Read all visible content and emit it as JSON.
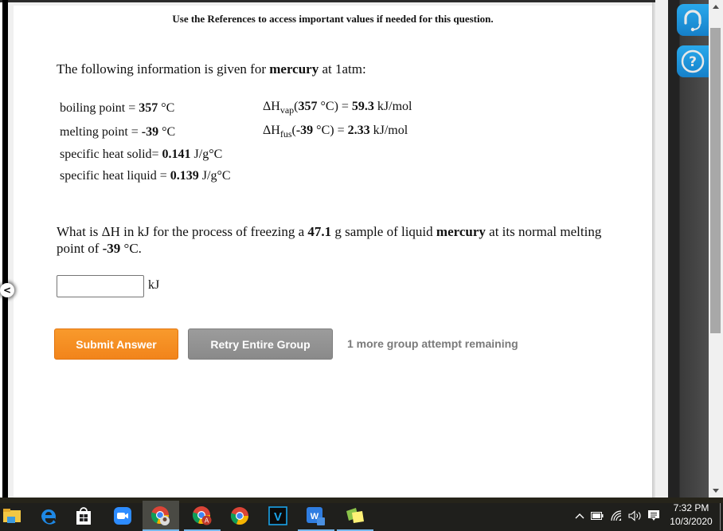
{
  "page": {
    "references_note": "Use the References to access important values if needed for this question."
  },
  "question": {
    "intro_prefix": "The following information is given for ",
    "intro_substance": "mercury",
    "intro_suffix": " at 1atm:",
    "properties": {
      "boiling_point_label": "boiling point = ",
      "boiling_point_value": "357",
      "boiling_point_unit": " °C",
      "melting_point_label": "melting point = ",
      "melting_point_value": "-39",
      "melting_point_unit": " °C",
      "specific_heat_solid_label": "specific heat solid= ",
      "specific_heat_solid_value": "0.141",
      "specific_heat_solid_unit": " J/g°C",
      "specific_heat_liquid_label": "specific heat liquid = ",
      "specific_heat_liquid_value": "0.139",
      "specific_heat_liquid_unit": " J/g°C",
      "dh_vap_symbol": "ΔH",
      "dh_vap_sub": "vap",
      "dh_vap_open": "(",
      "dh_vap_temp": "357",
      "dh_vap_mid": " °C) = ",
      "dh_vap_value": "59.3",
      "dh_vap_unit": " kJ/mol",
      "dh_fus_symbol": "ΔH",
      "dh_fus_sub": "fus",
      "dh_fus_open": "(",
      "dh_fus_temp": "-39",
      "dh_fus_mid": " °C) = ",
      "dh_fus_value": "2.33",
      "dh_fus_unit": " kJ/mol"
    },
    "prompt_part1": "What is ΔH in kJ for the process of freezing a ",
    "prompt_mass": "47.1",
    "prompt_part2": " g sample of liquid ",
    "prompt_substance": "mercury",
    "prompt_part3": " at its normal melting point of ",
    "prompt_temp": "-39",
    "prompt_part4": " °C.",
    "answer": {
      "value": "",
      "placeholder": "",
      "unit": "kJ"
    }
  },
  "actions": {
    "submit_label": "Submit Answer",
    "retry_label": "Retry Entire Group",
    "attempts_text": "1 more group attempt remaining"
  },
  "sidebar": {
    "collapse_label": "<",
    "tools": [
      {
        "icon": "headset-icon",
        "label": "Support"
      },
      {
        "icon": "help-icon",
        "label": "Help"
      }
    ]
  },
  "colors": {
    "submit": "#f2841b",
    "retry": "#8a8a8a",
    "tool_button": "#1a8fd8",
    "attempts_text": "#7a7a7a"
  },
  "taskbar": {
    "apps": [
      {
        "name": "file-explorer",
        "active": false,
        "running": false
      },
      {
        "name": "edge",
        "active": false,
        "running": false
      },
      {
        "name": "microsoft-store",
        "active": false,
        "running": false
      },
      {
        "name": "zoom",
        "active": false,
        "running": false
      },
      {
        "name": "chrome-profile-1",
        "active": true,
        "running": true
      },
      {
        "name": "chrome-profile-a",
        "active": false,
        "running": true
      },
      {
        "name": "chrome",
        "active": false,
        "running": false
      },
      {
        "name": "vegas",
        "active": false,
        "running": false,
        "label": "V"
      },
      {
        "name": "wps-office",
        "active": false,
        "running": true
      },
      {
        "name": "sticky-notes",
        "active": false,
        "running": true
      }
    ],
    "chrome_badge": "A",
    "time": "7:32 PM",
    "date": "10/3/2020"
  }
}
